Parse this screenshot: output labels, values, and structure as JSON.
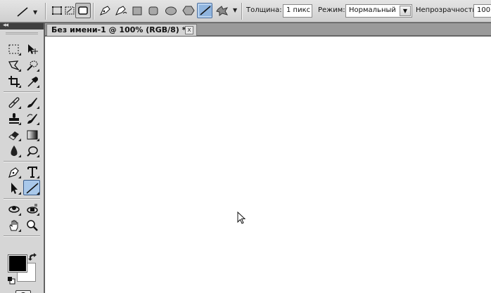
{
  "options_bar": {
    "tool_preset_icon": "line-tool-icon",
    "path_modes": [
      "shape-layers-icon",
      "paths-icon",
      "fill-pixels-icon"
    ],
    "shape_tools": [
      "pen-tool-icon",
      "freeform-pen-icon",
      "rectangle-icon",
      "rounded-rectangle-icon",
      "ellipse-icon",
      "polygon-icon",
      "line-tool-icon",
      "custom-shape-icon"
    ],
    "weight_label": "Толщина:",
    "weight_value": "1 пикс",
    "mode_label": "Режим:",
    "mode_value": "Нормальный",
    "opacity_label": "Непрозрачность",
    "opacity_value": "100"
  },
  "tools_panel": {
    "collapse_label": "◂◂",
    "tools": [
      "rectangular-marquee-icon",
      "move-icon",
      "lasso-icon",
      "quick-selection-icon",
      "crop-icon",
      "eyedropper-icon",
      "spot-healing-icon",
      "brush-icon",
      "clone-stamp-icon",
      "history-brush-icon",
      "eraser-icon",
      "gradient-icon",
      "blur-icon",
      "dodge-icon",
      "pen-icon",
      "type-icon",
      "path-selection-icon",
      "line-icon",
      "3d-rotate-icon",
      "3d-orbit-icon",
      "hand-icon",
      "zoom-icon"
    ],
    "foreground_color": "#000000",
    "background_color": "#ffffff"
  },
  "document": {
    "tab_title": "Без имени-1 @ 100% (RGB/8) *",
    "close_label": "x"
  },
  "colors": {
    "active_tool_bg": "#a9c8ea",
    "panel_bg": "#d6d6d6",
    "canvas_bg": "#ffffff"
  }
}
